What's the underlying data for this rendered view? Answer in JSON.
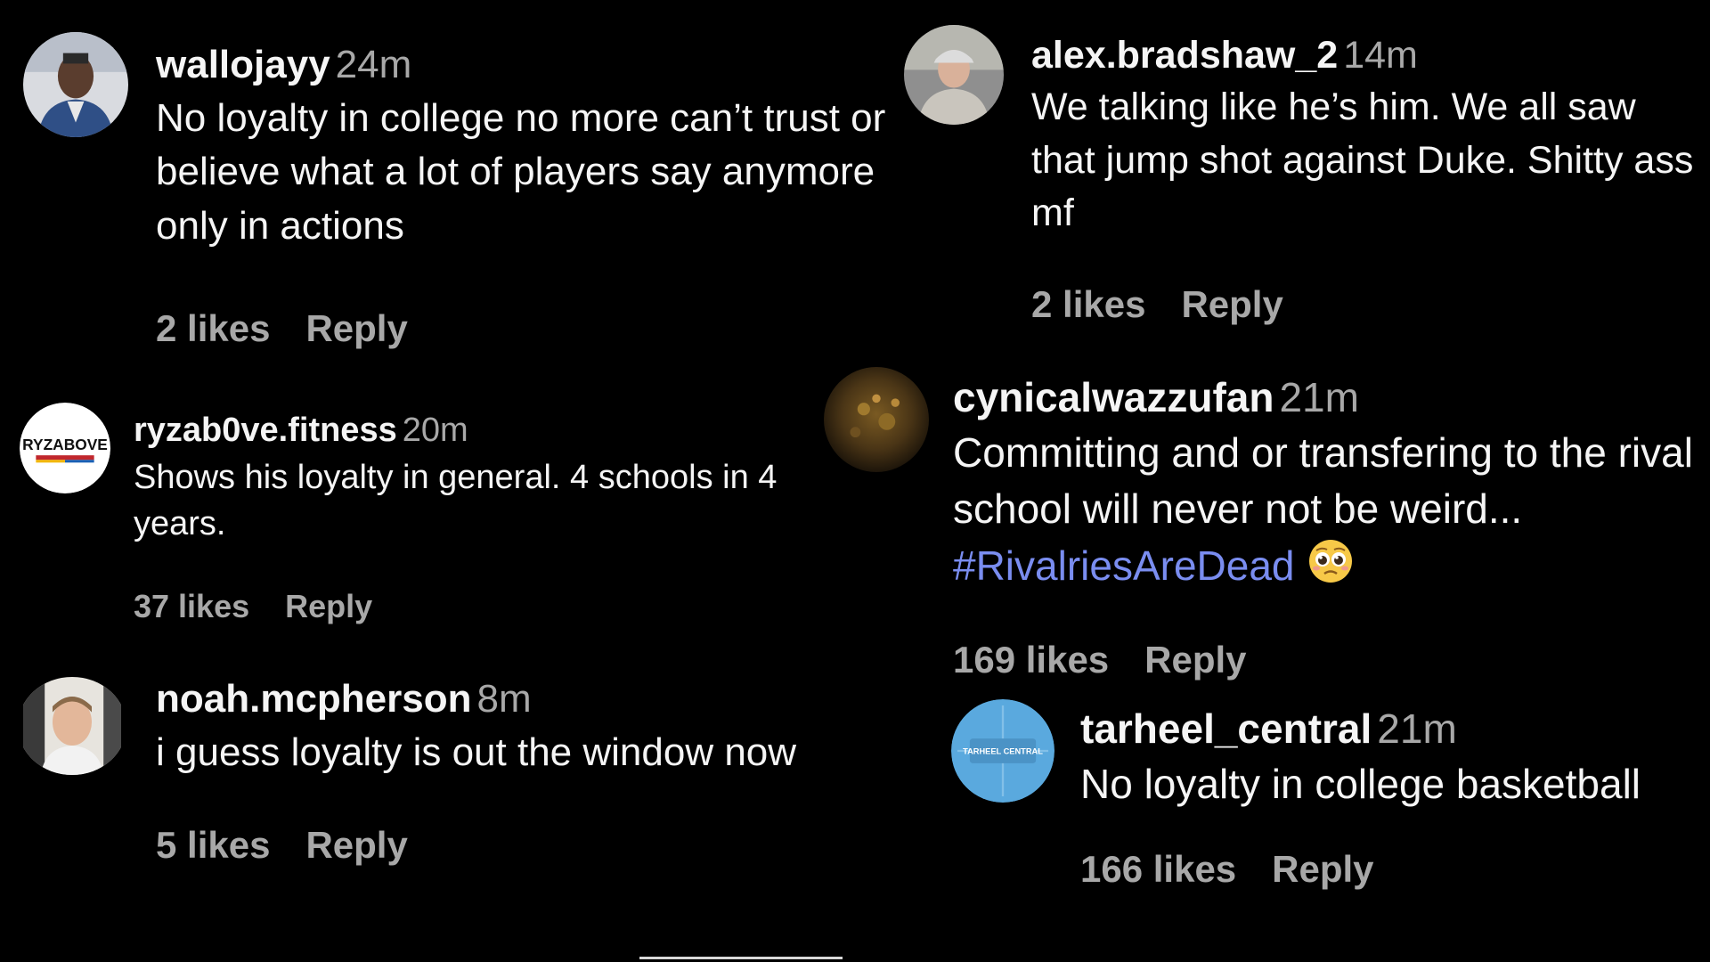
{
  "colors": {
    "background": "#000000",
    "text": "#f5f5f5",
    "muted": "#a8a8a8",
    "hashtag": "#7a8df0"
  },
  "comments": [
    {
      "username": "wallojayy",
      "time": "24m",
      "text": "No loyalty in college no more can’t trust or believe what a lot of players say anymore only in actions",
      "likes": "2 likes",
      "reply": "Reply",
      "avatar_icon": "profile-photo"
    },
    {
      "username": "ryzab0ve.fitness",
      "time": "20m",
      "text": "Shows his loyalty in general. 4 schools in 4 years.",
      "likes": "37 likes",
      "reply": "Reply",
      "avatar_icon": "ryz-above-logo",
      "avatar_logo_text": "RYZABOVE"
    },
    {
      "username": "noah.mcpherson",
      "time": "8m",
      "text": "i guess loyalty is out the window now",
      "likes": "5 likes",
      "reply": "Reply",
      "avatar_icon": "profile-photo"
    },
    {
      "username": "alex.bradshaw_2",
      "time": "14m",
      "text": "We talking like he’s him. We all saw that jump shot against Duke. Shitty ass mf",
      "likes": "2 likes",
      "reply": "Reply",
      "avatar_icon": "profile-photo"
    },
    {
      "username": "cynicalwazzufan",
      "time": "21m",
      "text": "Committing and or transfering to the rival school will never not be weird...",
      "hashtag": "#RivalriesAreDead",
      "emoji_icon": "pleading-face-emoji",
      "likes": "169 likes",
      "reply": "Reply",
      "avatar_icon": "profile-photo"
    },
    {
      "username": "tarheel_central",
      "time": "21m",
      "text": "No loyalty in college basketball",
      "likes": "166 likes",
      "reply": "Reply",
      "avatar_icon": "tarheel-central-logo",
      "avatar_logo_text": "TARHEEL CENTRAL"
    }
  ]
}
